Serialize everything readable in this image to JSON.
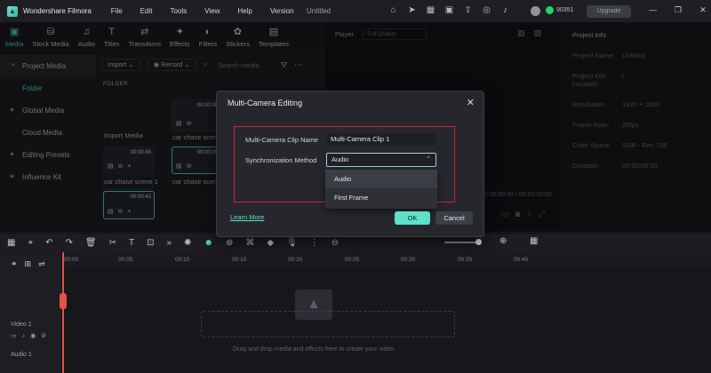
{
  "titlebar": {
    "app_name": "Wondershare Filmora",
    "menus": [
      "File",
      "Edit",
      "Tools",
      "View",
      "Help",
      "Version"
    ],
    "doc_title": "Untitled",
    "credits": "90351",
    "right_button": "Upgrade"
  },
  "toolbar": {
    "tabs": [
      {
        "label": "Media",
        "icon": "media-icon"
      },
      {
        "label": "Stock Media",
        "icon": "stock-media-icon"
      },
      {
        "label": "Audio",
        "icon": "audio-icon"
      },
      {
        "label": "Titles",
        "icon": "titles-icon"
      },
      {
        "label": "Transitions",
        "icon": "transitions-icon"
      },
      {
        "label": "Effects",
        "icon": "effects-icon"
      },
      {
        "label": "Filters",
        "icon": "filters-icon"
      },
      {
        "label": "Stickers",
        "icon": "stickers-icon"
      },
      {
        "label": "Templates",
        "icon": "templates-icon"
      }
    ]
  },
  "sidebar": {
    "items": [
      {
        "label": "Project Media"
      },
      {
        "label": "Folder"
      },
      {
        "label": "Global Media"
      },
      {
        "label": "Cloud Media"
      },
      {
        "label": "Editing Presets"
      },
      {
        "label": "Influence Kit"
      }
    ]
  },
  "media": {
    "import_label": "Import",
    "record_label": "Record",
    "search_placeholder": "Search media",
    "folder_heading": "FOLDER",
    "import_media_label": "Import Media",
    "clips": [
      {
        "caption": "car chase scene 1",
        "duration": "00:00:45"
      },
      {
        "caption": "car chase scene",
        "duration": "00:00:30"
      },
      {
        "caption": "car chase scene 1",
        "duration": "00:00:45"
      },
      {
        "caption": "car chase scene",
        "duration": "00:00:20"
      },
      {
        "caption": "",
        "duration": "00:00:42"
      }
    ]
  },
  "player": {
    "label": "Player",
    "quality": "Full Quality",
    "time": "00:00:00:00 / 00:00:00:00"
  },
  "project_info": {
    "title": "Project Info",
    "rows": [
      {
        "k": "Project Name:",
        "v": "Untitled"
      },
      {
        "k": "Project File Location:",
        "v": "/"
      },
      {
        "k": "Resolution:",
        "v": "1920 × 1080"
      },
      {
        "k": "Frame Rate:",
        "v": "25fps"
      },
      {
        "k": "Color Space:",
        "v": "SDR - Rec.709"
      },
      {
        "k": "Duration:",
        "v": "00:00:00:00"
      }
    ]
  },
  "timeline": {
    "ticks": [
      "00:00",
      "00:05",
      "00:10",
      "00:15",
      "00:20",
      "00:25",
      "00:30",
      "00:35",
      "00:40"
    ],
    "video_track": "Video 1",
    "audio_track": "Audio 1",
    "drop_text": "Drag and drop media and effects here to create your video."
  },
  "modal": {
    "title": "Multi-Camera Editing",
    "clip_name_label": "Multi-Camera Clip Name",
    "clip_name_value": "Multi-Camera Clip 1",
    "sync_label": "Synchronization Method",
    "sync_value": "Audio",
    "options": [
      "Audio",
      "First Frame"
    ],
    "learn_more": "Learn More",
    "ok": "OK",
    "cancel": "Cancel"
  },
  "colors": {
    "accent": "#5de1c8",
    "highlight_box": "#d5202e",
    "playhead": "#e0524a"
  }
}
